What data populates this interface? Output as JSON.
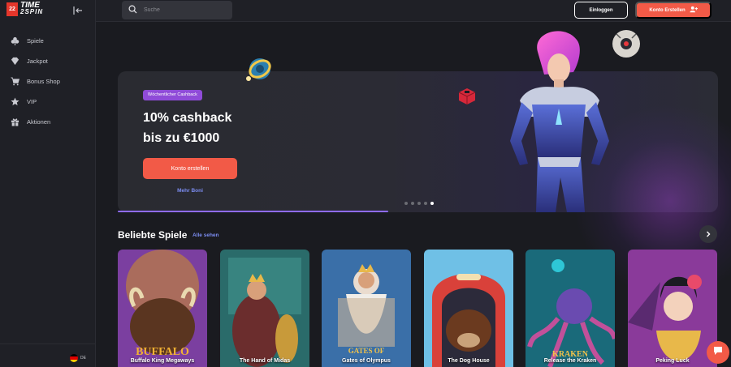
{
  "app": {
    "logo_top": "TIME",
    "logo_bottom": "2SPIN",
    "logo_mark": "22"
  },
  "sidebar": {
    "items": [
      {
        "label": "Spiele",
        "icon": "clover-icon"
      },
      {
        "label": "Jackpot",
        "icon": "diamond-icon"
      },
      {
        "label": "Bonus Shop",
        "icon": "cart-icon"
      },
      {
        "label": "VIP",
        "icon": "star-icon"
      },
      {
        "label": "Aktionen",
        "icon": "gift-icon"
      }
    ],
    "language": "DE"
  },
  "header": {
    "search_placeholder": "Suche",
    "login_label": "Einloggen",
    "register_label": "Konto Erstellen"
  },
  "banner": {
    "badge": "Wöchentlicher Cashback",
    "headline_line1": "10% cashback",
    "headline_line2": "bis zu €1000",
    "cta_label": "Konto erstellen",
    "more_label": "Mehr Boni",
    "slides_total": 5,
    "active_slide": 5,
    "progress": 0.45
  },
  "popular": {
    "title": "Beliebte Spiele",
    "see_all": "Alle sehen",
    "games": [
      {
        "name": "Buffalo King Megaways"
      },
      {
        "name": "The Hand of Midas"
      },
      {
        "name": "Gates of Olympus"
      },
      {
        "name": "The Dog House"
      },
      {
        "name": "Release the Kraken"
      },
      {
        "name": "Peking Luck"
      }
    ]
  },
  "colors": {
    "accent": "#f25a47",
    "badge": "#8f4bd8",
    "link": "#7b8cf0",
    "background": "#1a1b20"
  }
}
